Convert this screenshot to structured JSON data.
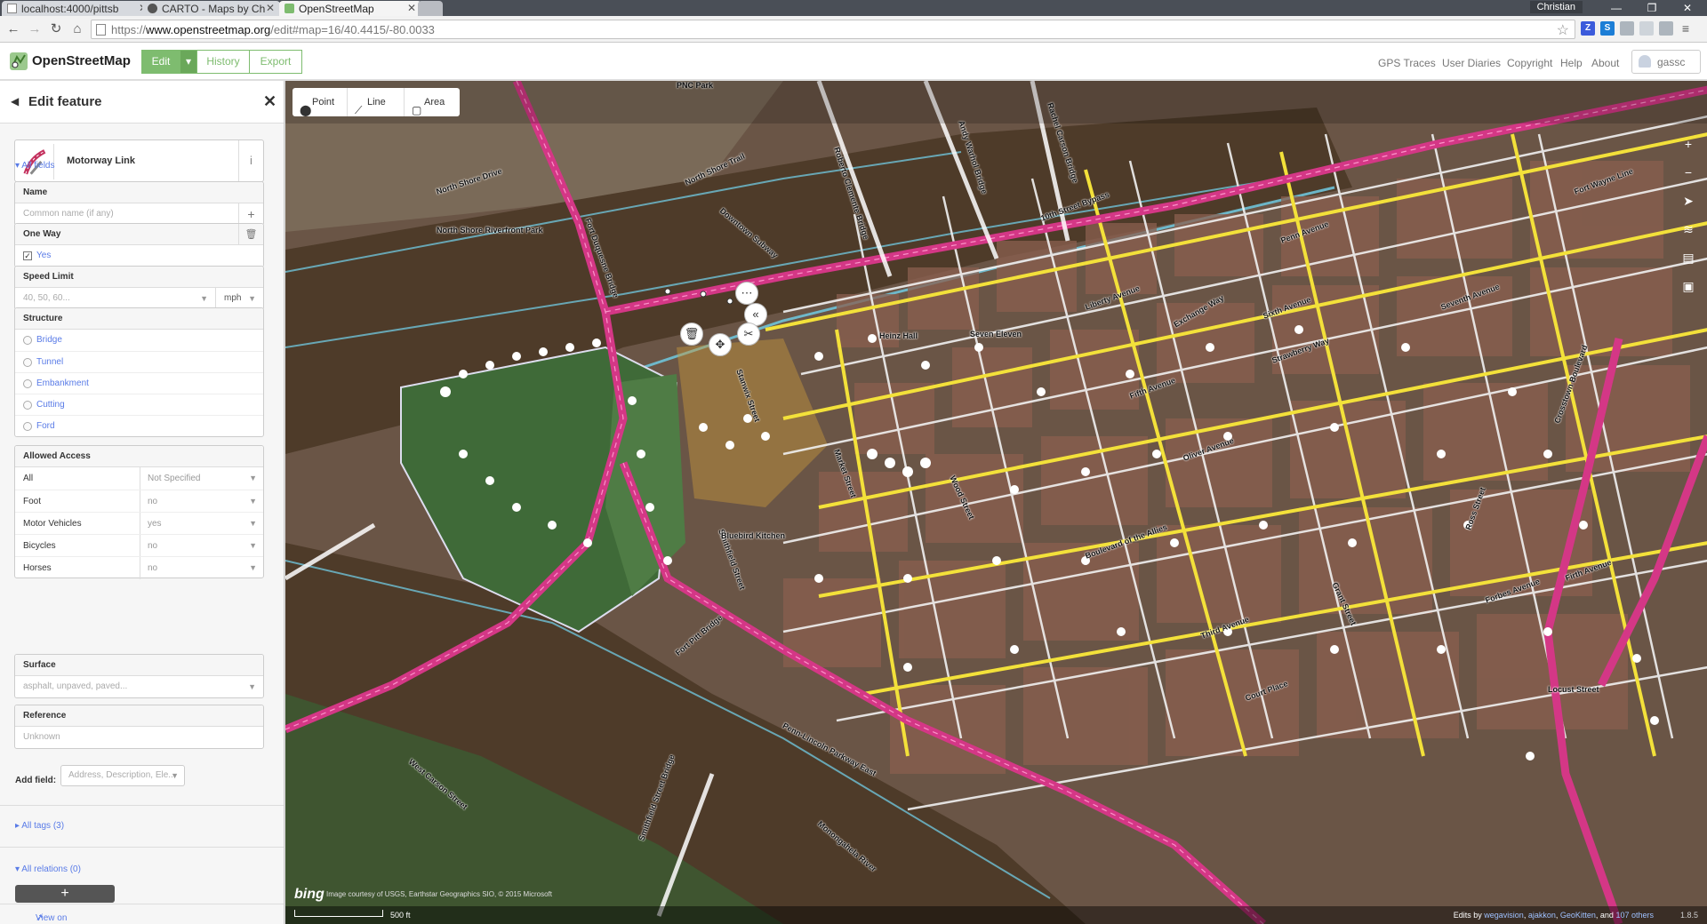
{
  "browser": {
    "tabs": [
      {
        "title": "localhost:4000/pittsb",
        "active": false
      },
      {
        "title": "CARTO - Maps by Ch",
        "active": false
      },
      {
        "title": "OpenStreetMap",
        "active": true
      }
    ],
    "user": "Christian",
    "url_scheme": "https://",
    "url_host": "www.openstreetmap.org",
    "url_path": "/edit#map=16/40.4415/-80.0033"
  },
  "header": {
    "title": "OpenStreetMap",
    "edit_label": "Edit",
    "history_label": "History",
    "export_label": "Export",
    "links": [
      "GPS Traces",
      "User Diaries",
      "Copyright",
      "Help",
      "About"
    ],
    "username": "gassc"
  },
  "sidebar": {
    "title": "Edit feature",
    "preset_name": "Motorway Link",
    "all_fields": "All fields",
    "name": {
      "label": "Name",
      "placeholder": "Common name (if any)"
    },
    "oneway": {
      "label": "One Way",
      "value": "Yes"
    },
    "speed": {
      "label": "Speed Limit",
      "placeholder": "40, 50, 60...",
      "unit": "mph"
    },
    "structure": {
      "label": "Structure",
      "options": [
        "Bridge",
        "Tunnel",
        "Embankment",
        "Cutting",
        "Ford"
      ]
    },
    "access": {
      "label": "Allowed Access",
      "rows": [
        {
          "label": "All",
          "value": "Not Specified"
        },
        {
          "label": "Foot",
          "value": "no"
        },
        {
          "label": "Motor Vehicles",
          "value": "yes"
        },
        {
          "label": "Bicycles",
          "value": "no"
        },
        {
          "label": "Horses",
          "value": "no"
        }
      ]
    },
    "surface": {
      "label": "Surface",
      "placeholder": "asphalt, unpaved, paved..."
    },
    "reference": {
      "label": "Reference",
      "placeholder": "Unknown"
    },
    "add_field_label": "Add field:",
    "add_field_placeholder": "Address, Description, Ele...",
    "all_tags": "All tags (3)",
    "all_relations": "All relations (0)",
    "view_on_osm": "View on openstreetmap.org"
  },
  "map": {
    "tools": [
      "Point",
      "Line",
      "Area"
    ],
    "scale": "500 ft",
    "attribution": "Image courtesy of USGS, Earthstar Geographics SIO, © 2015 Microsoft",
    "edits_prefix": "Edits by",
    "editors": [
      "wegavision",
      "ajakkon",
      "GeoKitten"
    ],
    "edits_suffix_and": "and",
    "others": "107 others",
    "version": "1.8.5",
    "labels": [
      "North Shore Drive",
      "North Shore Trail",
      "North Shore Riverfront Park",
      "Fort Duquesne Bridge",
      "Roberto Clemente Bridge",
      "Andy Warhol Bridge",
      "Rachel Carson Bridge",
      "Downtown Subway",
      "10th Street Bypass",
      "Penn Avenue",
      "Liberty Avenue",
      "Fifth Avenue",
      "Forbes Avenue",
      "Boulevard of the Allies",
      "Fort Pitt Bridge",
      "Penn-Lincoln Parkway East",
      "Monongahela River",
      "Smithfield Street Bridge",
      "West Carson Street",
      "Grant Street",
      "Wood Street",
      "Smithfield Street",
      "Stanwix Street",
      "Market Street",
      "Seven Eleven",
      "Heinz Hall",
      "Fort Wayne Line",
      "Exchange Way",
      "Oliver Avenue",
      "Sixth Avenue",
      "Seventh Avenue",
      "Strawberry Way",
      "Third Avenue",
      "Court Place",
      "Ross Street",
      "Crosstown Boulevard",
      "Locust Street",
      "PNC Park",
      "Bluebird Kitchen",
      "Firth Avenue"
    ]
  }
}
